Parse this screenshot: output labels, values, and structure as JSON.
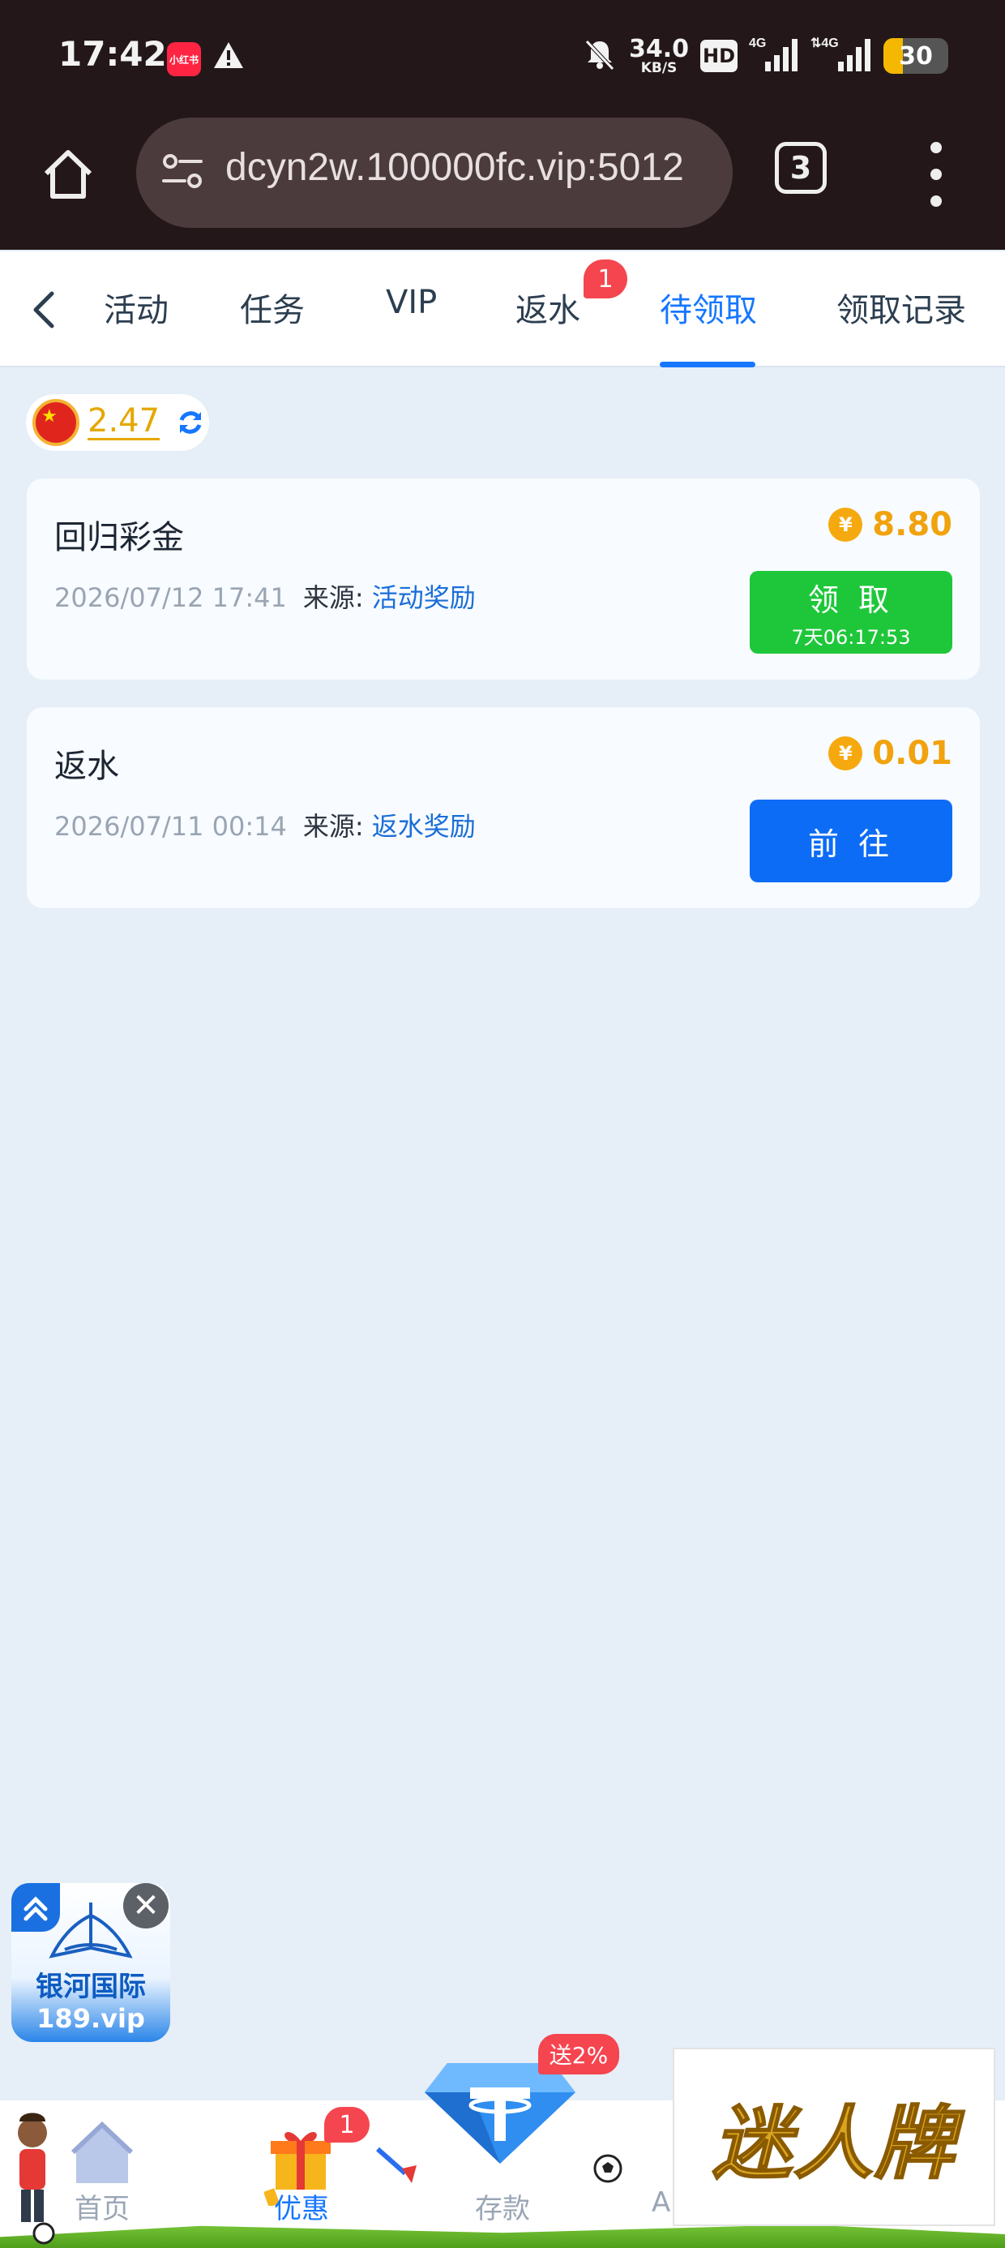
{
  "status_bar": {
    "time": "17:42",
    "app_badge": "小红书",
    "net_speed": "34.0",
    "net_unit": "KB/S",
    "hd": "HD",
    "network1": "4G",
    "network2": "4G",
    "battery": "30",
    "battery_level": 0.3
  },
  "browser": {
    "url": "dcyn2w.100000fc.vip:5012",
    "tab_count": "3"
  },
  "tabs": [
    {
      "label": "活动"
    },
    {
      "label": "任务"
    },
    {
      "label": "VIP"
    },
    {
      "label": "返水",
      "badge": "1"
    },
    {
      "label": "待领取",
      "active": true
    },
    {
      "label": "领取记录"
    }
  ],
  "balance": {
    "amount": "2.47"
  },
  "rewards": [
    {
      "title": "回归彩金",
      "date": "2026/07/12 17:41",
      "source_label": "来源:",
      "source": "活动奖励",
      "coin_symbol": "¥",
      "amount": "8.80",
      "button": "领 取",
      "button_sub": "7天06:17:53"
    },
    {
      "title": "返水",
      "date": "2026/07/11 00:14",
      "source_label": "来源:",
      "source": "返水奖励",
      "coin_symbol": "¥",
      "amount": "0.01",
      "button": "前 往"
    }
  ],
  "float_ad": {
    "name": "银河国际",
    "url": "189.vip"
  },
  "bottom_nav": {
    "items": [
      {
        "label": "首页"
      },
      {
        "label": "优惠",
        "badge": "1",
        "active": true
      },
      {
        "label": "存款",
        "badge": "送2%"
      },
      {
        "label": "AI"
      }
    ]
  },
  "brand_ad": {
    "text": "迷人牌"
  },
  "colors": {
    "accent": "#1677ff",
    "claim_green": "#1ec73a",
    "go_blue": "#0d6cf5",
    "coin_gold": "#f0a30e",
    "badge_red": "#f5454f"
  }
}
